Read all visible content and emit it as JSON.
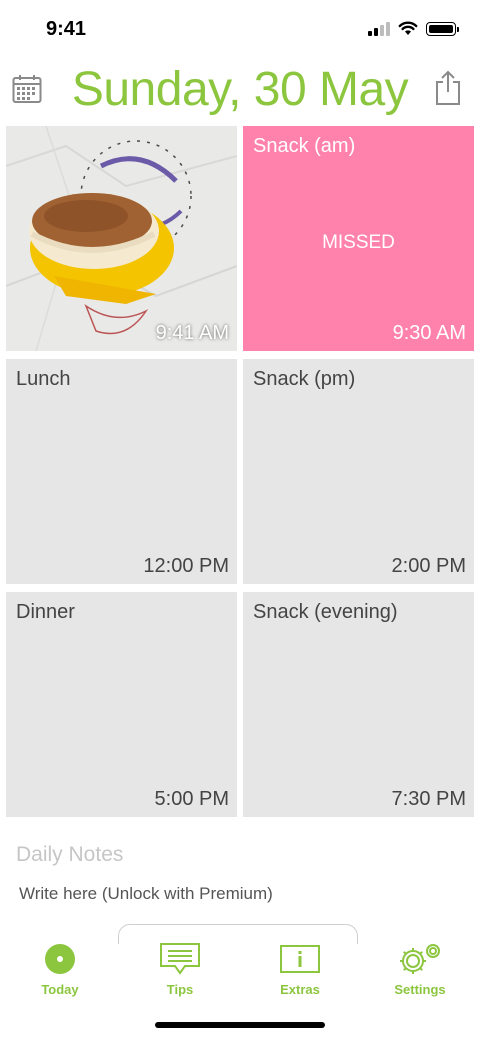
{
  "status_bar": {
    "time": "9:41"
  },
  "header": {
    "date_title": "Sunday, 30 May"
  },
  "meals": [
    {
      "label": "",
      "time": "9:41 AM",
      "status": ""
    },
    {
      "label": "Snack (am)",
      "time": "9:30 AM",
      "status": "MISSED"
    },
    {
      "label": "Lunch",
      "time": "12:00 PM",
      "status": ""
    },
    {
      "label": "Snack (pm)",
      "time": "2:00 PM",
      "status": ""
    },
    {
      "label": "Dinner",
      "time": "5:00 PM",
      "status": ""
    },
    {
      "label": "Snack (evening)",
      "time": "7:30 PM",
      "status": ""
    }
  ],
  "notes": {
    "title": "Daily Notes",
    "placeholder": "Write here (Unlock with Premium)"
  },
  "tabs": [
    {
      "label": "Today",
      "icon": "today-icon"
    },
    {
      "label": "Tips",
      "icon": "tips-icon"
    },
    {
      "label": "Extras",
      "icon": "extras-icon"
    },
    {
      "label": "Settings",
      "icon": "settings-icon"
    }
  ],
  "colors": {
    "accent": "#8cc63f",
    "missed": "#ff82ad",
    "tile": "#e6e6e6"
  }
}
